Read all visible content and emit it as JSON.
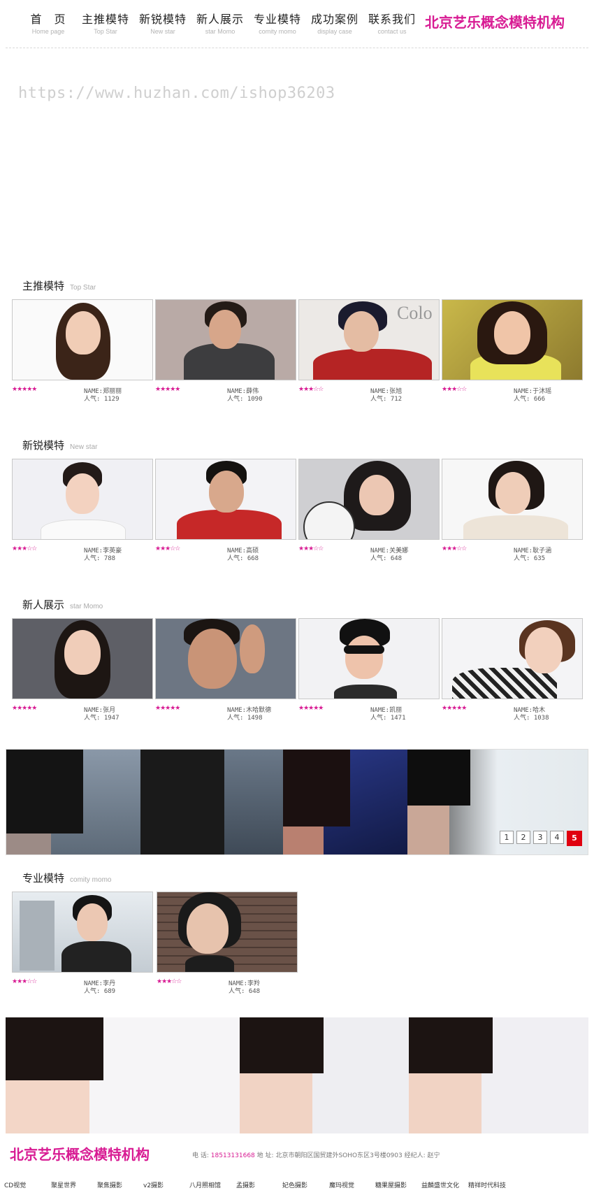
{
  "header": {
    "nav": [
      {
        "zh": "首　页",
        "en": "Home page"
      },
      {
        "zh": "主推模特",
        "en": "Top Star"
      },
      {
        "zh": "新锐模特",
        "en": "New star"
      },
      {
        "zh": "新人展示",
        "en": "star Momo"
      },
      {
        "zh": "专业模特",
        "en": "comity momo"
      },
      {
        "zh": "成功案例",
        "en": "display case"
      },
      {
        "zh": "联系我们",
        "en": "contact us"
      }
    ],
    "brand": "北京艺乐概念模特机构"
  },
  "watermark": "https://www.huzhan.com/ishop36203",
  "sections": [
    {
      "title": "主推模特",
      "subtitle": "Top Star",
      "models": [
        {
          "stars": "★★★★★",
          "name": "NAME:郑丽丽",
          "popularity": "人气: 1129",
          "rating": 5
        },
        {
          "stars": "★★★★★",
          "name": "NAME:薛伟",
          "popularity": "人气: 1090",
          "rating": 5
        },
        {
          "stars": "★★★☆☆",
          "name": "NAME:张旭",
          "popularity": "人气: 712",
          "rating": 3
        },
        {
          "stars": "★★★☆☆",
          "name": "NAME:于沐瑶",
          "popularity": "人气: 666",
          "rating": 3
        }
      ]
    },
    {
      "title": "新锐模特",
      "subtitle": "New star",
      "models": [
        {
          "stars": "★★★☆☆",
          "name": "NAME:李英豪",
          "popularity": "人气: 788",
          "rating": 3
        },
        {
          "stars": "★★★☆☆",
          "name": "NAME:高硕",
          "popularity": "人气: 668",
          "rating": 3
        },
        {
          "stars": "★★★☆☆",
          "name": "NAME:关美娜",
          "popularity": "人气: 648",
          "rating": 3
        },
        {
          "stars": "★★★☆☆",
          "name": "NAME:耿子涵",
          "popularity": "人气: 635",
          "rating": 3
        }
      ]
    },
    {
      "title": "新人展示",
      "subtitle": "star Momo",
      "models": [
        {
          "stars": "★★★★★",
          "name": "NAME:张月",
          "popularity": "人气: 1947",
          "rating": 5
        },
        {
          "stars": "★★★★★",
          "name": "NAME:木哈默德",
          "popularity": "人气: 1498",
          "rating": 5
        },
        {
          "stars": "★★★★★",
          "name": "NAME:凯丽",
          "popularity": "人气: 1471",
          "rating": 5
        },
        {
          "stars": "★★★★★",
          "name": "NAME:哈木",
          "popularity": "人气: 1038",
          "rating": 5
        }
      ]
    },
    {
      "title": "专业模特",
      "subtitle": "comity momo",
      "models": [
        {
          "stars": "★★★☆☆",
          "name": "NAME:李丹",
          "popularity": "人气: 689",
          "rating": 3
        },
        {
          "stars": "★★★☆☆",
          "name": "NAME:李羚",
          "popularity": "人气: 648",
          "rating": 3
        }
      ]
    }
  ],
  "banner": {
    "pages": [
      "1",
      "2",
      "3",
      "4",
      "5"
    ],
    "active_page": "5"
  },
  "footer": {
    "brand": "北京艺乐概念模特机构",
    "phone_label": "电  话:",
    "phone": "18513131668",
    "address_label": "地  址:",
    "address": "北京市朝阳区国贸建外SOHO东区3号楼0903",
    "agent_label": "经纪人:",
    "agent": "赵宁",
    "links": [
      "CD视觉",
      "聚星世界",
      "聚焦摄影",
      "v2摄影",
      "八月照相馆",
      "孟摄影",
      "妃色摄影",
      "魔玛视觉",
      "糖果屋摄影",
      "益麟盛世文化",
      "精祥时代科技"
    ]
  },
  "colors": {
    "brand": "#d81b93",
    "active_pager": "#e0000f"
  }
}
